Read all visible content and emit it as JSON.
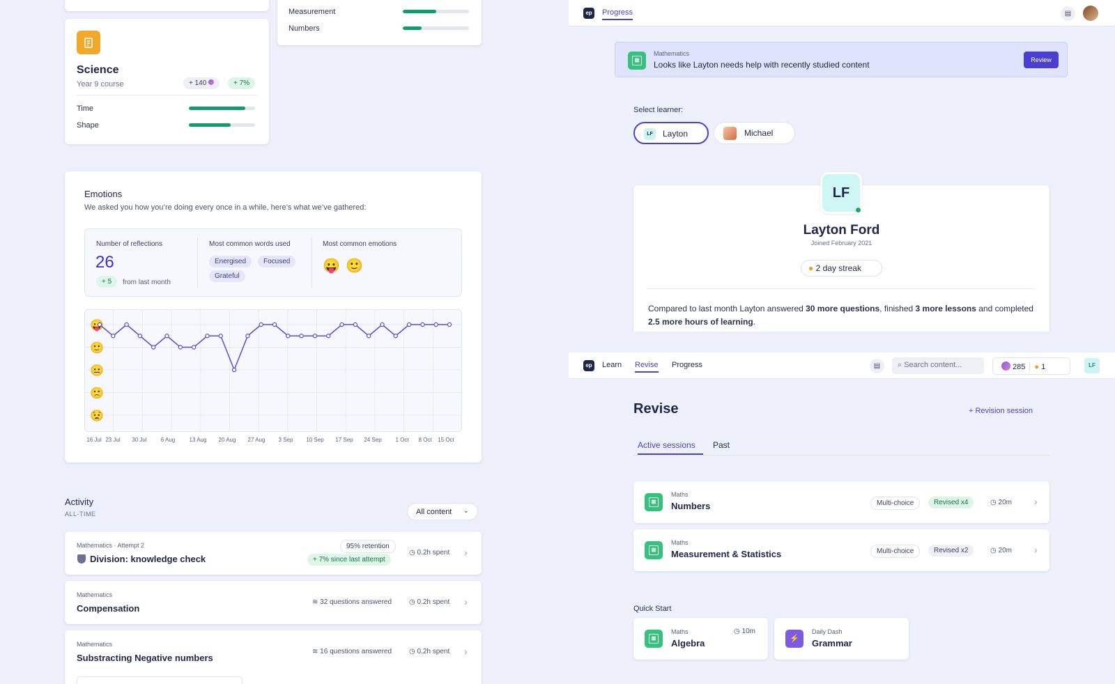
{
  "science_card": {
    "title": "Science",
    "subtitle": "Year 9 course",
    "points_badge": "+ 140",
    "growth_badge": "+ 7%",
    "bars": [
      {
        "label": "Time",
        "progress": 0.85
      },
      {
        "label": "Shape",
        "progress": 0.63
      }
    ]
  },
  "top_subject_card": {
    "bars": [
      {
        "label": "Measurement",
        "progress": 0.51
      },
      {
        "label": "Numbers",
        "progress": 0.28
      }
    ]
  },
  "emotions": {
    "title": "Emotions",
    "description": "We asked you how you’re doing every once in a while, here’s what we’ve gathered:",
    "reflections_label": "Number of reflections",
    "reflections_count": "26",
    "reflections_delta": "+ 5",
    "reflections_delta_note": "from last month",
    "words_label": "Most common words used",
    "words": [
      "Energised",
      "Focused",
      "Grateful"
    ],
    "emotions_label": "Most common emotions",
    "emotion_emojis": [
      "😛",
      "🙂"
    ],
    "y_emojis": [
      "😛",
      "🙂",
      "😐",
      "🙁",
      "😟"
    ]
  },
  "chart_data": {
    "type": "line",
    "x_labels": [
      "16 Jul",
      "23 Jul",
      "30 Jul",
      "6 Aug",
      "13 Aug",
      "20 Aug",
      "27 Aug",
      "3 Sep",
      "10 Sep",
      "17 Sep",
      "24 Sep",
      "1 Oct",
      "8 Oct",
      "15 Oct"
    ],
    "y_levels": [
      "very happy",
      "happy",
      "neutral",
      "sad",
      "very sad"
    ],
    "values": [
      4.0,
      3.5,
      4.0,
      3.5,
      3.0,
      3.5,
      3.0,
      3.0,
      3.5,
      3.5,
      2.0,
      3.5,
      4.0,
      4.0,
      3.5,
      3.5,
      3.5,
      3.5,
      4.0,
      4.0,
      3.5,
      4.0,
      3.5,
      4.0,
      4.0,
      4.0,
      4.0
    ],
    "ylim": [
      0,
      5
    ]
  },
  "activity": {
    "title": "Activity",
    "subtitle": "ALL-TIME",
    "filter": "All content",
    "items": [
      {
        "subject": "Mathematics · Attempt 2",
        "title": "Division: knowledge check",
        "retention": "95% retention",
        "delta": "+ 7% since last attempt",
        "time": "0.2h spent"
      },
      {
        "subject": "Mathematics",
        "title": "Compensation",
        "questions": "32 questions answered",
        "time": "0.2h spent"
      },
      {
        "subject": "Mathematics",
        "title": "Substracting Negative numbers",
        "questions": "16 questions answered",
        "time": "0.2h spent"
      }
    ]
  },
  "parent": {
    "nav_progress": "Progress",
    "alert_subject": "Mathematics",
    "alert_text": "Looks like Layton needs help with recently studied content",
    "alert_button": "Review",
    "select_label": "Select learner:",
    "learners": [
      {
        "initials": "LF",
        "name": "Layton"
      },
      {
        "name": "Michael"
      }
    ],
    "avatar_initials": "LF",
    "name": "Layton Ford",
    "joined": "Joined February 2021",
    "streak": "2 day streak",
    "summary_1": "Compared to last month Layton answered ",
    "summary_b1": "30 more questions",
    "summary_2": ", finished ",
    "summary_b2": "3 more lessons",
    "summary_3": " and completed ",
    "summary_b3": "2.5 more hours of learning",
    "summary_4": "."
  },
  "revise": {
    "nav": {
      "learn": "Learn",
      "revise": "Revise",
      "progress": "Progress",
      "search_placeholder": "Search content...",
      "points": "285",
      "streak": "1",
      "avatar": "LF"
    },
    "title": "Revise",
    "new_session": "Revision session",
    "tabs": [
      "Active sessions",
      "Past"
    ],
    "sessions": [
      {
        "subject": "Maths",
        "title": "Numbers",
        "type": "Multi-choice",
        "revised": "Revised x4",
        "time": "20m"
      },
      {
        "subject": "Maths",
        "title": "Measurement & Statistics",
        "type": "Multi-choice",
        "revised": "Revised x2",
        "time": "20m"
      }
    ],
    "quick_start_label": "Quick Start",
    "quick": [
      {
        "subject": "Maths",
        "title": "Algebra",
        "time": "10m"
      },
      {
        "subject": "Daily Dash",
        "title": "Grammar"
      }
    ]
  },
  "colors": {
    "accent": "#4a3fd1",
    "success": "#0f9d6a",
    "chart_line": "#5b4bdb"
  }
}
